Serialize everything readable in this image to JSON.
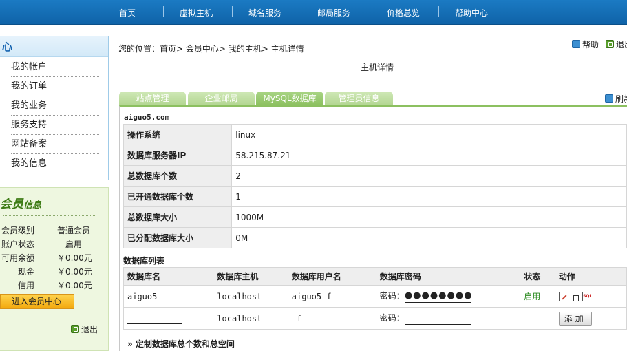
{
  "nav": {
    "items": [
      "首页",
      "虚拟主机",
      "域名服务",
      "邮局服务",
      "价格总览",
      "帮助中心"
    ]
  },
  "sidebar": {
    "heading": "心",
    "items": [
      "我的帐户",
      "我的订单",
      "我的业务",
      "服务支持",
      "网站备案",
      "我的信息"
    ]
  },
  "member": {
    "title_main": "会员",
    "title_small": "信息",
    "rows": [
      {
        "label": "会员级别",
        "value": "普通会员"
      },
      {
        "label": "账户状态",
        "value": "启用"
      },
      {
        "label": "可用余额",
        "value": "￥0.00元"
      },
      {
        "label": "现金",
        "value": "￥0.00元"
      },
      {
        "label": "信用",
        "value": "￥0.00元"
      }
    ],
    "enter_button": "进入会员中心",
    "logout": "退出"
  },
  "header": {
    "breadcrumb": "您的位置：首页> 会员中心> 我的主机> 主机详情",
    "help": "帮助",
    "logout": "退出",
    "page_title": "主机详情"
  },
  "tabs": [
    "站点管理",
    "企业邮局",
    "MySQL数据库",
    "管理员信息"
  ],
  "active_tab": "MySQL数据库",
  "refresh": "刷新",
  "host": "aiguo5.com",
  "info": [
    {
      "label": "操作系统",
      "value": "linux"
    },
    {
      "label": "数据库服务器IP",
      "value": "58.215.87.21"
    },
    {
      "label": "总数据库个数",
      "value": "2"
    },
    {
      "label": "已开通数据库个数",
      "value": "1"
    },
    {
      "label": "总数据库大小",
      "value": "1000M"
    },
    {
      "label": "已分配数据库大小",
      "value": "0M"
    }
  ],
  "db_list": {
    "title": "数据库列表",
    "headers": [
      "数据库名",
      "数据库主机",
      "数据库用户名",
      "数据库密码",
      "状态",
      "动作"
    ],
    "rows": [
      {
        "name": "aiguo5",
        "host": "localhost",
        "user": "aiguo5_f",
        "pwd_label": "密码：",
        "pwd_value": "●●●●●●●●",
        "status": "启用"
      },
      {
        "name": "",
        "host": "localhost",
        "user": "_f",
        "pwd_label": "密码：",
        "pwd_value": "",
        "status": "-",
        "action": "添加"
      }
    ]
  },
  "custom_link": "» 定制数据库总个数和总空间",
  "colors": {
    "nav": "#1670b8",
    "tab": "#b3d692",
    "tab_active": "#8cc060",
    "status_on": "#2a8a1f"
  }
}
